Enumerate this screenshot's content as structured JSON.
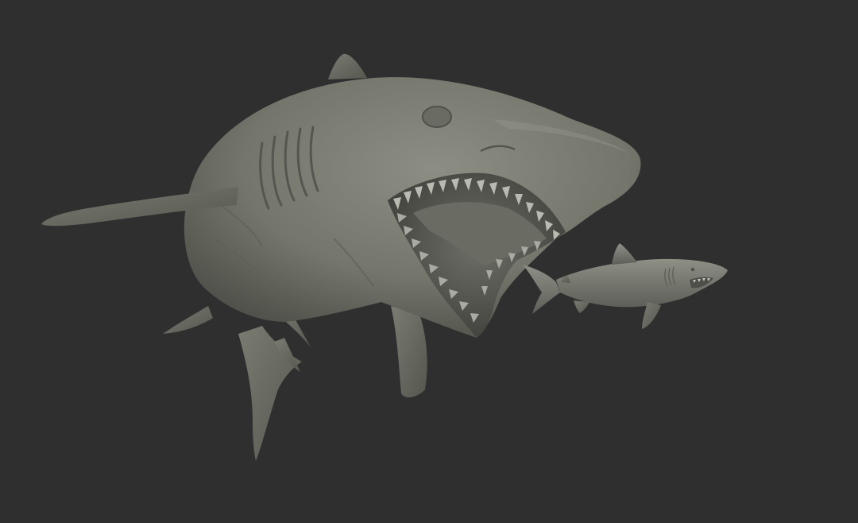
{
  "scene": {
    "background_color": "#2f2f2f",
    "model_color": "#77796f",
    "model_shadow_color": "#4d4f48",
    "model_highlight_color": "#9a9c92",
    "mouth_color": "#5a5b54",
    "teeth_color": "#b9bab2",
    "subjects": [
      {
        "id": "large-shark",
        "kind": "shark-sculpt",
        "pose": "mouth-open-attacking"
      },
      {
        "id": "small-shark",
        "kind": "shark-sculpt",
        "pose": "swimming"
      }
    ]
  }
}
